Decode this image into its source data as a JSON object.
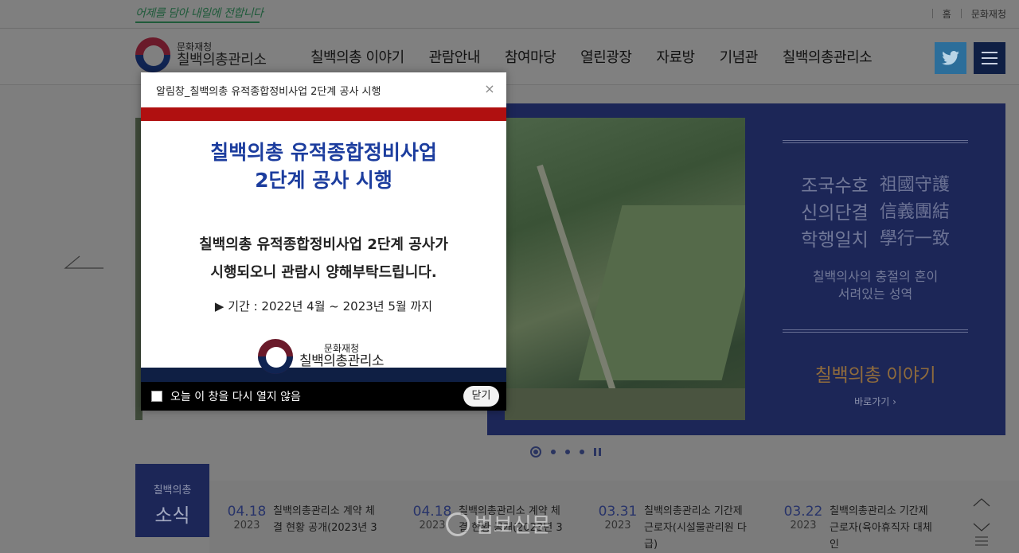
{
  "top": {
    "slogan": "어제를 담아 내일에 전합니다",
    "links": [
      "홈",
      "문화재청"
    ]
  },
  "header": {
    "logo_small": "문화재청",
    "logo_big": "칠백의총관리소",
    "nav": [
      "칠백의총 이야기",
      "관람안내",
      "참여마당",
      "열린광장",
      "자료방",
      "기념관",
      "칠백의총관리소"
    ],
    "twitter_icon": "twitter-icon",
    "menu_icon": "hamburger-icon"
  },
  "visual": {
    "mottos": [
      {
        "kor": "조국수호",
        "han": "祖國守護"
      },
      {
        "kor": "신의단결",
        "han": "信義團結"
      },
      {
        "kor": "학행일치",
        "han": "學行一致"
      }
    ],
    "sub_line1": "칠백의사의 충절의 혼이",
    "sub_line2": "서려있는 성역",
    "title": "칠백의총 이야기",
    "more": "바로가기 ›",
    "panel_color": "#1c2657"
  },
  "news": {
    "label_small": "칠백의총",
    "label_big": "소식",
    "items": [
      {
        "md": "04.18",
        "yr": "2023",
        "title": "칠백의총관리소 계약 체결 현황 공개(2023년 3"
      },
      {
        "md": "04.18",
        "yr": "2023",
        "title": "칠백의총관리소 계약 체결 현황 공개(2023년 3"
      },
      {
        "md": "03.31",
        "yr": "2023",
        "title": "칠백의총관리소 기간제근로자(시설물관리원 다급)"
      },
      {
        "md": "03.22",
        "yr": "2023",
        "title": "칠백의총관리소 기간제근로자(육아휴직자 대체인"
      }
    ]
  },
  "watermark": "법보신문",
  "popup": {
    "window_title": "알림창_칠백의총 유적종합정비사업 2단계 공사 시행",
    "close_glyph": "×",
    "title_line1": "칠백의총 유적종합정비사업",
    "title_line2": "2단계 공사 시행",
    "desc_line1": "칠백의총 유적종합정비사업 2단계 공사가",
    "desc_line2": "시행되오니 관람시 양해부탁드립니다.",
    "period": "▶ 기간 : 2022년 4월 ~ 2023년 5월 까지",
    "logo_small": "문화재청",
    "logo_big": "칠백의총관리소",
    "dont_show_label": "오늘 이 창을 다시 열지 않음",
    "close_label": "닫기",
    "accent_red": "#b01010",
    "accent_navy": "#0f1f44"
  }
}
